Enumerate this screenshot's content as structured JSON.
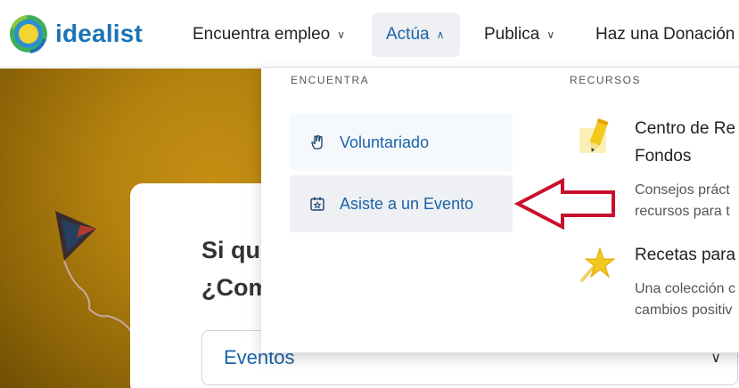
{
  "brand": {
    "name": "idealist"
  },
  "nav": [
    {
      "label": "Encuentra empleo",
      "icon": "chevron-down-icon"
    },
    {
      "label": "Actúa",
      "icon": "chevron-up-icon",
      "active": true
    },
    {
      "label": "Publica",
      "icon": "chevron-down-icon"
    },
    {
      "label": "Haz una Donación"
    }
  ],
  "hero": {
    "title_line1": "Si qu",
    "title_line2": "¿Com",
    "select_value": "Eventos"
  },
  "dropdown": {
    "encuentra": {
      "heading": "ENCUENTRA",
      "items": [
        {
          "label": "Voluntariado",
          "icon": "hand-icon"
        },
        {
          "label": "Asiste a un Evento",
          "icon": "calendar-star-icon"
        }
      ]
    },
    "recursos": {
      "heading": "RECURSOS",
      "items": [
        {
          "title_line1": "Centro de Re",
          "title_line2": "Fondos",
          "desc_line1": "Consejos práct",
          "desc_line2": "recursos para t",
          "icon": "pencil-icon"
        },
        {
          "title_line1": "Recetas para",
          "desc_line1": "Una colección c",
          "desc_line2": "cambios positiv",
          "icon": "star-icon"
        }
      ]
    }
  },
  "colors": {
    "accent": "#1a63a8",
    "annotation_arrow": "#c8102e",
    "hero_bg": "#b4830f"
  }
}
